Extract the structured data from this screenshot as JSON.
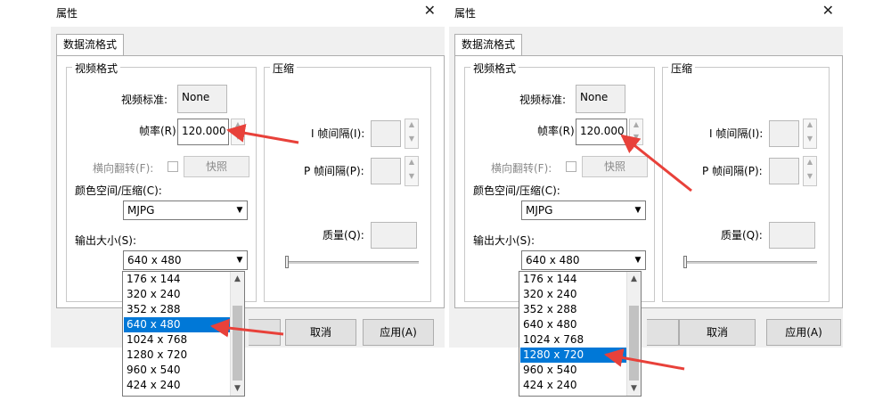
{
  "dialog": {
    "title": "属性",
    "close_glyph": "✕",
    "tab": "数据流格式",
    "video_format": {
      "title": "视频格式",
      "standard_label": "视频标准:",
      "standard_value": "None",
      "framerate_label": "帧率(R):",
      "framerate_value": "120.000",
      "flip_label": "横向翻转(F):",
      "snapshot_button": "快照",
      "colorspace_label": "颜色空间/压缩(C):",
      "colorspace_value": "MJPG",
      "output_size_label": "输出大小(S):",
      "output_size_value": "640 x 480"
    },
    "compression": {
      "title": "压缩",
      "i_frame_label": "I 帧间隔(I):",
      "p_frame_label": "P 帧间隔(P):",
      "quality_label": "质量(Q):"
    },
    "buttons": {
      "cancel": "取消",
      "apply": "应用(A)"
    }
  },
  "output_size_options": [
    "176 x 144",
    "320 x 240",
    "352 x 288",
    "640 x 480",
    "1024 x 768",
    "1280 x 720",
    "960 x 540",
    "424 x 240"
  ],
  "left_selected": "640 x 480",
  "right_selected": "1280 x 720",
  "annotation_color": "#e8413a",
  "highlight_color": "#0078d7"
}
